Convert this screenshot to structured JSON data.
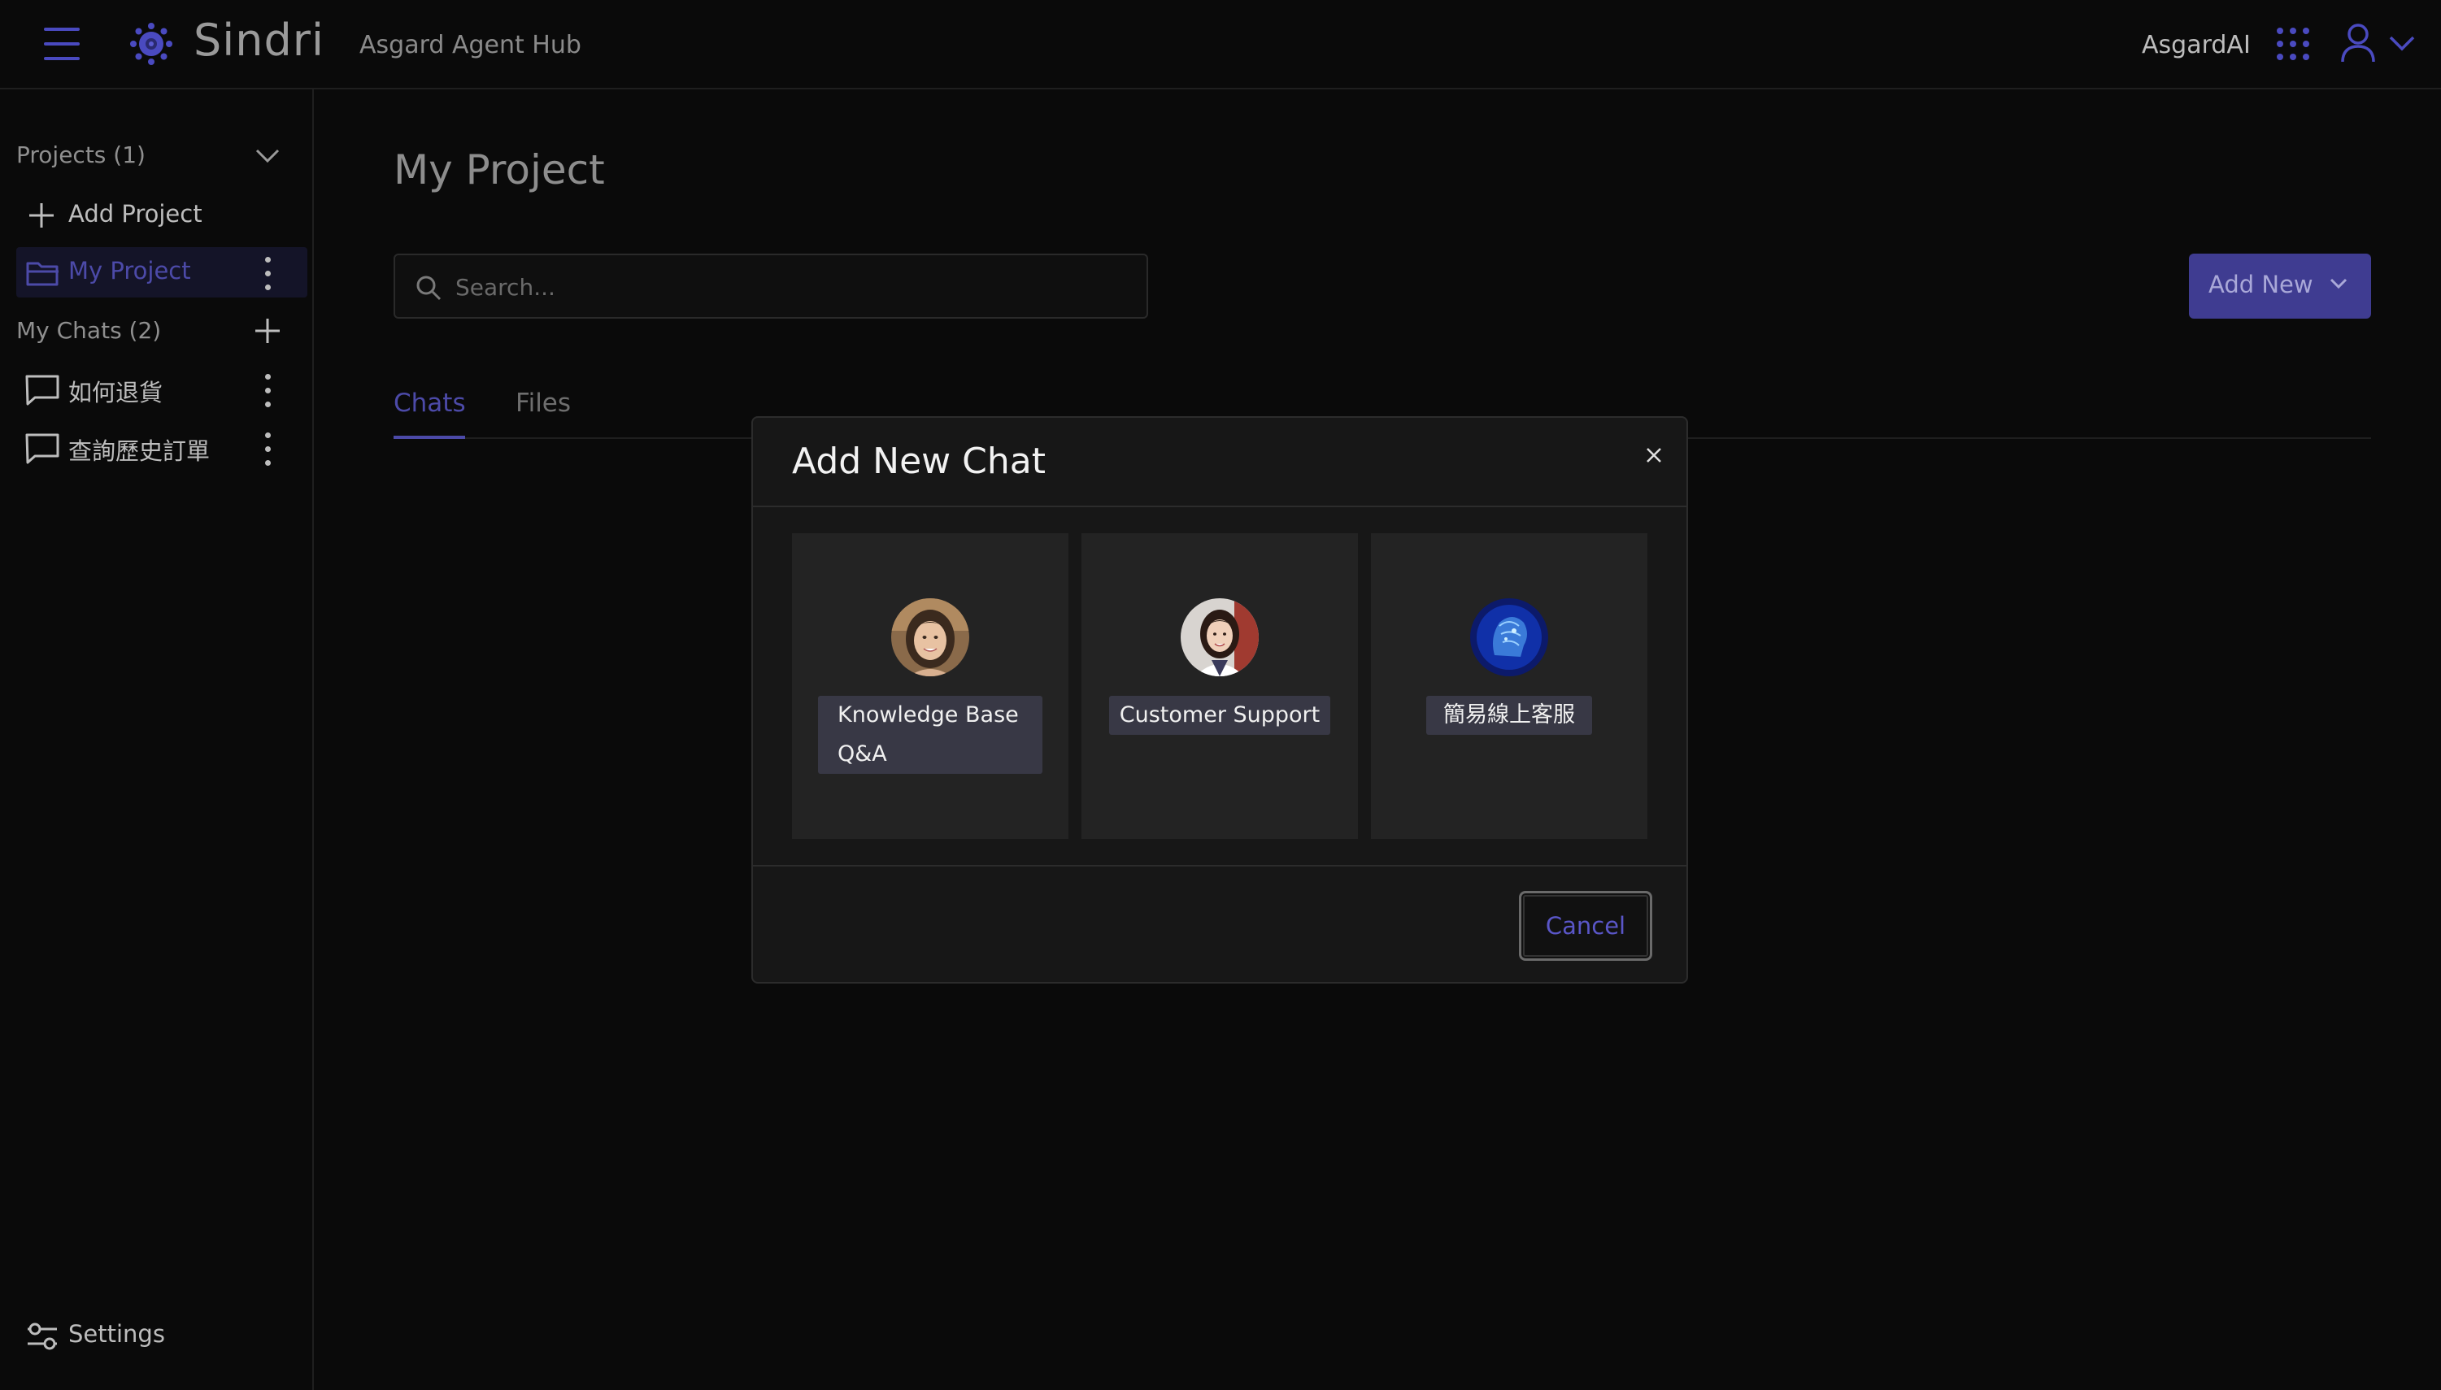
{
  "header": {
    "brand": "Sindri",
    "hub_name": "Asgard Agent Hub",
    "org_name": "AsgardAI",
    "icons": [
      "hamburger-menu-icon",
      "sindri-logo-icon",
      "apps-grid-icon",
      "user-icon",
      "chevron-down-icon"
    ]
  },
  "sidebar": {
    "projects_label": "Projects (1)",
    "add_project": "Add Project",
    "projects": [
      {
        "label": "My Project",
        "active": true
      }
    ],
    "chats_label": "My Chats (2)",
    "chats": [
      {
        "label": "如何退貨"
      },
      {
        "label": "查詢歷史訂單"
      }
    ],
    "settings": "Settings"
  },
  "main": {
    "title": "My Project",
    "search": {
      "placeholder": "Search...",
      "value": ""
    },
    "add_new": "Add New",
    "tabs": [
      {
        "label": "Chats",
        "active": true
      },
      {
        "label": "Files",
        "active": false
      }
    ]
  },
  "modal": {
    "title": "Add New Chat",
    "close_symbol": "×",
    "agents": [
      {
        "label_line1": "Knowledge Base",
        "label_line2": "Q&A"
      },
      {
        "label": "Customer Support"
      },
      {
        "label": "簡易線上客服"
      }
    ],
    "cancel": "Cancel"
  },
  "colors": {
    "accent": "#4c4aa8",
    "button_bg": "#3f3c91",
    "background": "#0a0a0a",
    "modal_bg": "#171717",
    "card_bg": "#232323"
  }
}
